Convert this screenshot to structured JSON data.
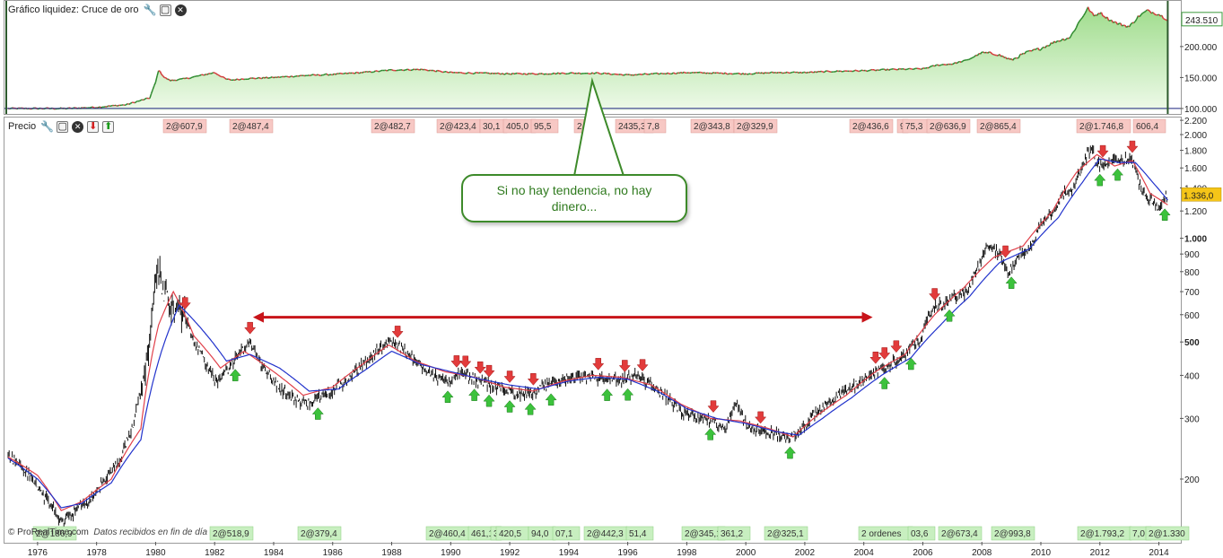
{
  "equity_panel": {
    "title": "Gráfico liquidez: Cruce de oro",
    "current_value": "243.510",
    "y_ticks": [
      {
        "label": "200.000",
        "value": 200000
      },
      {
        "label": "150.000",
        "value": 150000
      },
      {
        "label": "100.000",
        "value": 100000
      }
    ]
  },
  "price_panel": {
    "title": "Precio",
    "current_value": "1.336,0"
  },
  "callout": {
    "text": "Si no hay tendencia, no hay dinero..."
  },
  "watermark": {
    "brand": "© ProRealTime.com",
    "note": "Datos recibidos en fin de día"
  },
  "colors": {
    "background": "#ffffff",
    "price_bars": "#111111",
    "moving_average_blue": "#2233cc",
    "moving_average_red": "#e0404a",
    "equity_fill": "#b8e6a8",
    "equity_line_up": "#2e8a2e",
    "equity_line_down": "#d23a3a",
    "sell_label_bg": "#f7c8c4",
    "buy_label_bg": "#c8efc0",
    "arrow_sell": "#e23b3b",
    "arrow_buy": "#3cc23c",
    "range_arrow": "#c8141a",
    "callout_border": "#3d8a2a",
    "current_price_bg": "#f5c518",
    "current_equity_border": "#3a9a3a"
  },
  "chart_data": [
    {
      "type": "area",
      "title": "Gráfico liquidez: Cruce de oro",
      "xlabel": "",
      "ylabel": "",
      "xlim": [
        1975.0,
        2014.5
      ],
      "ylim": [
        97000,
        265000
      ],
      "grid": false,
      "x": [
        1975.0,
        1977.0,
        1978.0,
        1979.0,
        1979.8,
        1980.0,
        1980.1,
        1980.3,
        1980.5,
        1981.0,
        1981.5,
        1982.0,
        1982.4,
        1982.6,
        1983.0,
        1984.0,
        1985.0,
        1986.0,
        1987.0,
        1988.0,
        1989.0,
        1990.0,
        1991.0,
        1992.0,
        1993.0,
        1994.0,
        1995.0,
        1996.0,
        1997.0,
        1998.0,
        1999.0,
        2000.0,
        2001.0,
        2002.0,
        2003.0,
        2004.0,
        2005.0,
        2006.0,
        2006.5,
        2007.0,
        2007.5,
        2008.0,
        2008.5,
        2009.0,
        2009.5,
        2010.0,
        2010.5,
        2011.0,
        2011.3,
        2011.6,
        2011.8,
        2012.0,
        2012.3,
        2012.6,
        2013.0,
        2013.3,
        2013.6,
        2014.0,
        2014.3
      ],
      "y": [
        100000,
        100000,
        102000,
        106000,
        117000,
        142000,
        162000,
        150000,
        145000,
        148000,
        153000,
        158000,
        147000,
        146000,
        148000,
        150000,
        153000,
        155000,
        158000,
        162000,
        163000,
        158000,
        157000,
        156000,
        156000,
        157000,
        157000,
        154000,
        156000,
        158000,
        157000,
        156000,
        158000,
        158000,
        160000,
        161000,
        163000,
        164000,
        170000,
        172000,
        178000,
        190000,
        188000,
        178000,
        190000,
        197000,
        208000,
        215000,
        240000,
        262000,
        249000,
        255000,
        244000,
        237000,
        232000,
        248000,
        258000,
        252000,
        243510
      ]
    },
    {
      "type": "line",
      "title": "Precio",
      "xlabel": "",
      "ylabel": "",
      "scale": "log",
      "xlim": [
        1975.0,
        2014.5
      ],
      "ylim": [
        160,
        2200
      ],
      "x_ticks": [
        "1976",
        "1978",
        "1980",
        "1982",
        "1984",
        "1986",
        "1988",
        "1990",
        "1992",
        "1994",
        "1996",
        "1998",
        "2000",
        "2002",
        "2004",
        "2006",
        "2008",
        "2010",
        "2012",
        "2014"
      ],
      "y_ticks": [
        {
          "label": "2.200",
          "value": 2200
        },
        {
          "label": "2.000",
          "value": 2000
        },
        {
          "label": "1.800",
          "value": 1800
        },
        {
          "label": "1.600",
          "value": 1600
        },
        {
          "label": "1.400",
          "value": 1400
        },
        {
          "label": "1.200",
          "value": 1200
        },
        {
          "label": "1.000",
          "value": 1000,
          "bold": true
        },
        {
          "label": "900",
          "value": 900
        },
        {
          "label": "800",
          "value": 800
        },
        {
          "label": "700",
          "value": 700
        },
        {
          "label": "600",
          "value": 600
        },
        {
          "label": "500",
          "value": 500,
          "bold": true
        },
        {
          "label": "400",
          "value": 400
        },
        {
          "label": "300",
          "value": 300
        },
        {
          "label": "200",
          "value": 200
        }
      ],
      "series": [
        {
          "x": [
            1975.0,
            1975.5,
            1976.0,
            1976.5,
            1976.8,
            1977.2,
            1977.8,
            1978.3,
            1978.8,
            1979.2,
            1979.6,
            1979.9,
            1980.05,
            1980.3,
            1980.6,
            1980.9,
            1981.3,
            1981.7,
            1982.1,
            1982.5,
            1982.9,
            1983.2,
            1983.6,
            1984.0,
            1984.5,
            1985.0,
            1985.4,
            1985.9,
            1986.4,
            1986.9,
            1987.4,
            1987.9,
            1988.3,
            1988.8,
            1989.3,
            1989.8,
            1990.3,
            1990.8,
            1991.3,
            1991.8,
            1992.3,
            1992.8,
            1993.3,
            1993.8,
            1994.3,
            1994.8,
            1995.3,
            1995.8,
            1996.3,
            1996.8,
            1997.3,
            1997.8,
            1998.3,
            1998.8,
            1999.3,
            1999.7,
            2000.0,
            2000.5,
            2001.0,
            2001.5,
            2001.9,
            2002.4,
            2002.9,
            2003.4,
            2003.9,
            2004.4,
            2004.9,
            2005.4,
            2005.9,
            2006.3,
            2006.6,
            2007.0,
            2007.5,
            2007.9,
            2008.2,
            2008.6,
            2008.9,
            2009.3,
            2009.7,
            2010.0,
            2010.4,
            2010.8,
            2011.2,
            2011.5,
            2011.7,
            2011.9,
            2012.2,
            2012.5,
            2012.8,
            2013.1,
            2013.4,
            2013.7,
            2014.0,
            2014.3
          ],
          "values": [
            235,
            215,
            190,
            165,
            150,
            160,
            175,
            200,
            225,
            280,
            390,
            600,
            850,
            680,
            640,
            620,
            500,
            430,
            380,
            420,
            470,
            500,
            430,
            385,
            350,
            330,
            340,
            360,
            380,
            420,
            460,
            510,
            480,
            440,
            410,
            380,
            405,
            390,
            375,
            365,
            355,
            355,
            375,
            390,
            395,
            395,
            390,
            385,
            400,
            375,
            345,
            315,
            300,
            300,
            280,
            330,
            290,
            275,
            270,
            265,
            280,
            310,
            340,
            360,
            380,
            410,
            430,
            460,
            510,
            620,
            640,
            670,
            700,
            830,
            950,
            900,
            800,
            900,
            950,
            1100,
            1200,
            1350,
            1450,
            1700,
            1850,
            1650,
            1620,
            1700,
            1700,
            1680,
            1400,
            1300,
            1230,
            1336
          ]
        },
        {
          "name": "",
          "x": [
            1975.0,
            1976.0,
            1976.8,
            1977.5,
            1978.5,
            1979.5,
            1980.2,
            1980.8,
            1981.6,
            1982.4,
            1983.2,
            1984.2,
            1985.2,
            1986.2,
            1987.2,
            1988.0,
            1989.0,
            1990.0,
            1991.0,
            1992.0,
            1993.0,
            1994.0,
            1995.0,
            1996.0,
            1997.0,
            1998.0,
            1999.0,
            2000.0,
            2001.0,
            2001.8,
            2002.6,
            2003.6,
            2004.6,
            2005.6,
            2006.6,
            2007.6,
            2008.6,
            2009.6,
            2010.6,
            2011.4,
            2012.0,
            2012.6,
            2013.2,
            2013.8,
            2014.3
          ],
          "values": [
            230,
            200,
            165,
            170,
            195,
            260,
            470,
            640,
            540,
            440,
            460,
            420,
            360,
            365,
            420,
            470,
            430,
            410,
            390,
            375,
            365,
            385,
            395,
            390,
            360,
            320,
            300,
            290,
            275,
            268,
            300,
            345,
            400,
            450,
            560,
            680,
            850,
            930,
            1150,
            1450,
            1700,
            1660,
            1660,
            1450,
            1290
          ]
        },
        {
          "name": "",
          "x": [
            1975.0,
            1976.0,
            1976.8,
            1977.5,
            1978.5,
            1979.5,
            1980.1,
            1980.6,
            1981.3,
            1982.2,
            1983.0,
            1984.0,
            1985.0,
            1986.0,
            1987.0,
            1987.9,
            1988.8,
            1989.8,
            1990.8,
            1991.8,
            1992.8,
            1993.8,
            1994.8,
            1995.8,
            1996.8,
            1997.8,
            1998.8,
            1999.8,
            2000.8,
            2001.6,
            2002.4,
            2003.4,
            2004.4,
            2005.4,
            2006.4,
            2007.4,
            2008.4,
            2009.4,
            2010.4,
            2011.2,
            2011.9,
            2012.5,
            2013.1,
            2013.7,
            2014.3
          ],
          "values": [
            232,
            205,
            162,
            172,
            200,
            280,
            560,
            700,
            520,
            420,
            470,
            410,
            350,
            370,
            430,
            490,
            440,
            410,
            395,
            370,
            360,
            385,
            400,
            395,
            375,
            330,
            300,
            295,
            280,
            265,
            305,
            350,
            410,
            460,
            600,
            720,
            880,
            950,
            1200,
            1550,
            1750,
            1620,
            1680,
            1350,
            1250
          ]
        }
      ],
      "sell_labels": [
        "2@607,9",
        "2@487,4",
        "2@482,7",
        "2@423,4",
        "30,1",
        "405,0",
        "95,5",
        "2@4",
        "2435,3",
        "7,8",
        "2@343,8",
        "2@329,9",
        "2@436,6",
        "9",
        "75,3",
        "2@636,9",
        "2@865,4",
        "2@1.746,8",
        "606,4"
      ],
      "buy_labels": [
        "2@186,9",
        "2@518,9",
        "2@379,4",
        "2@460,4",
        "461,1",
        "3",
        "420,5",
        "94,0",
        "07,1",
        "2@442,3",
        "51,4",
        "2@345,1",
        "361,2",
        "2@325,1",
        "2 ordenes",
        "03,6",
        "2@673,4",
        "2@993,8",
        "2@1.793,2",
        "7,0",
        "2@1.330"
      ],
      "sell_arrows_x": [
        1981.0,
        1983.2,
        1988.2,
        1990.2,
        1990.5,
        1991.0,
        1991.3,
        1992.0,
        1992.8,
        1995.0,
        1995.9,
        1996.5,
        1998.9,
        2000.5,
        2004.4,
        2004.7,
        2005.1,
        2006.4,
        2008.8,
        2012.1,
        2013.1
      ],
      "buy_arrows_x": [
        1977.0,
        1982.7,
        1985.5,
        1989.9,
        1990.8,
        1991.3,
        1992.0,
        1992.7,
        1993.4,
        1995.3,
        1996.0,
        1998.8,
        2001.5,
        2004.7,
        2005.6,
        2006.9,
        2009.0,
        2012.0,
        2012.6,
        2014.2
      ],
      "range_arrow": {
        "x_start": 1983.3,
        "x_end": 2004.3,
        "y": 590
      }
    }
  ]
}
